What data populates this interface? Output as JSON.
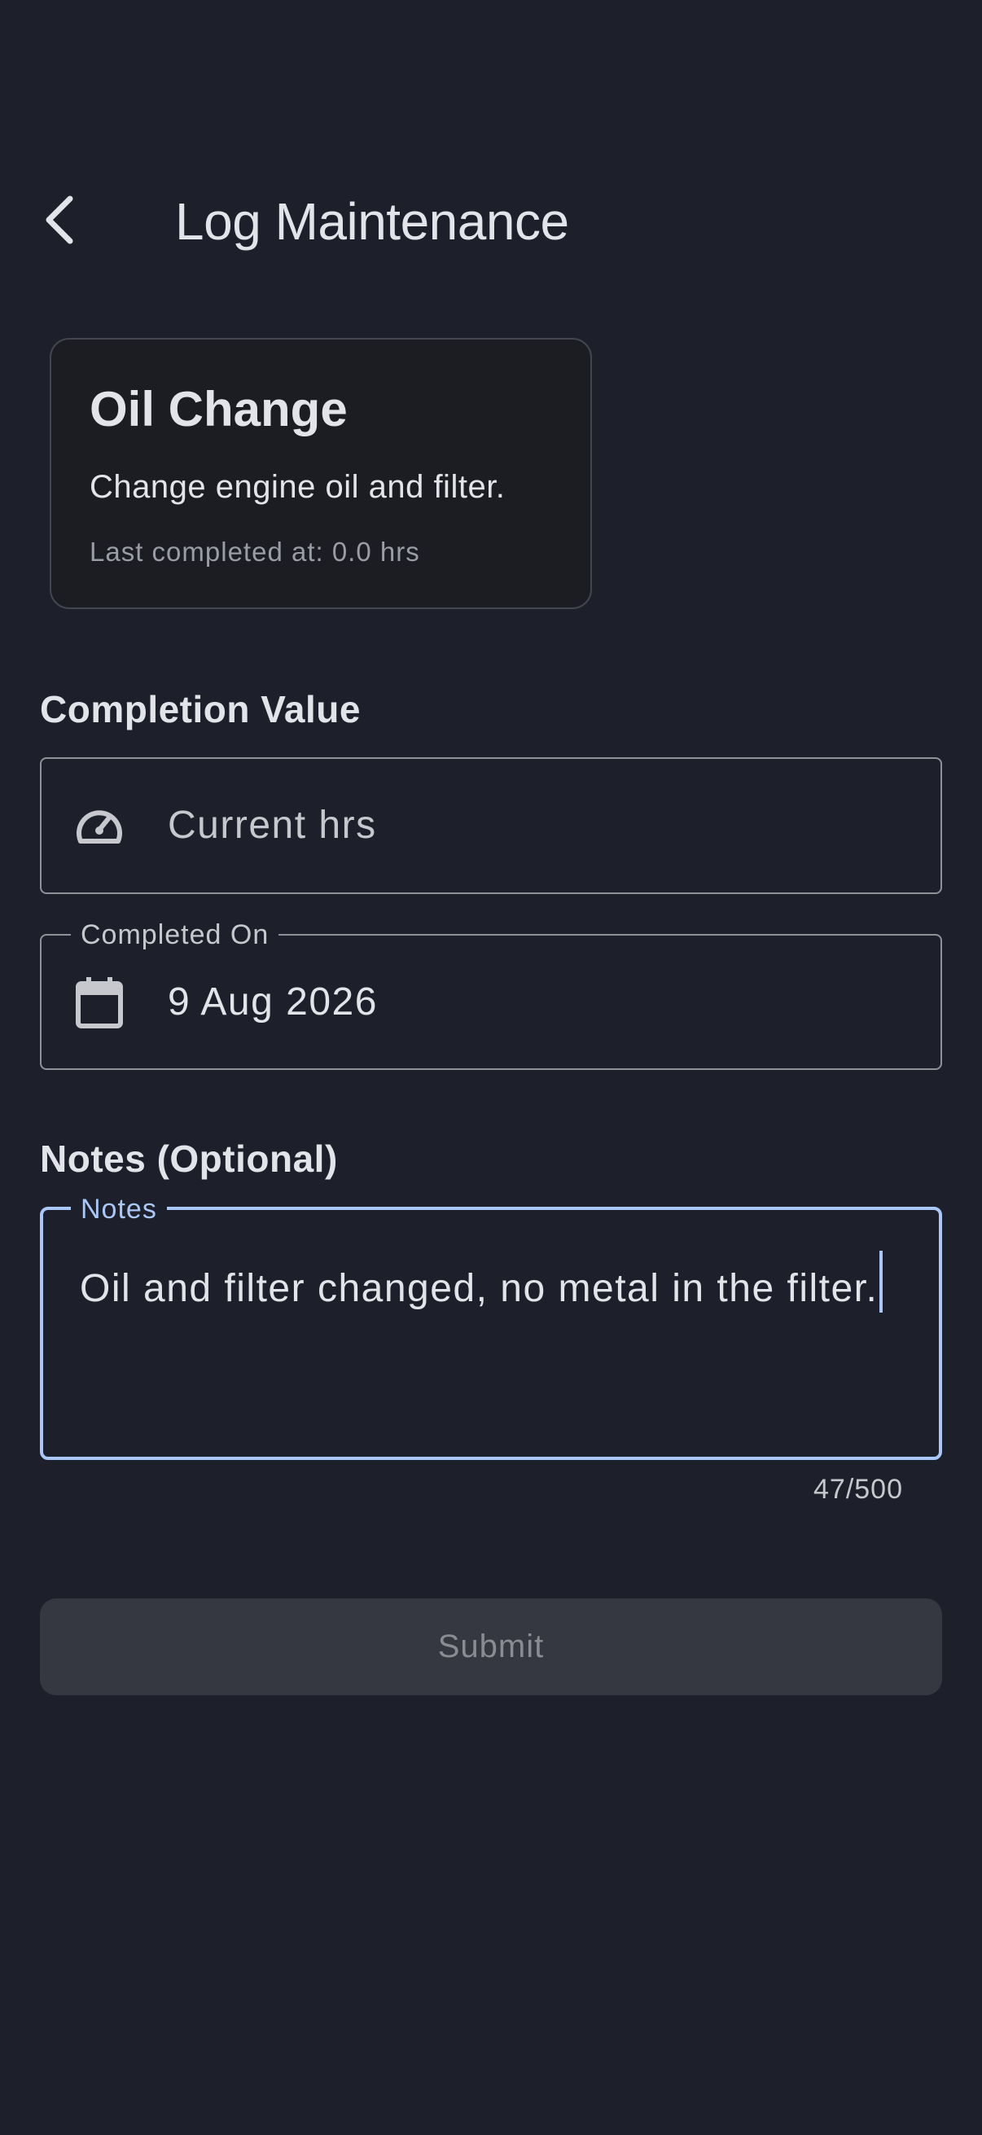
{
  "header": {
    "title": "Log Maintenance",
    "back_icon": "chevron-left-icon"
  },
  "task": {
    "title": "Oil Change",
    "description": "Change engine oil and filter.",
    "last_completed": "Last completed at: 0.0 hrs"
  },
  "completion": {
    "section_label": "Completion Value",
    "icon": "speedometer-icon",
    "placeholder": "Current hrs",
    "value": ""
  },
  "completed_on": {
    "label": "Completed On",
    "icon": "calendar-icon",
    "value": "9 Aug 2026"
  },
  "notes": {
    "section_label": "Notes (Optional)",
    "label": "Notes",
    "value": "Oil and filter changed, no metal in the filter.",
    "counter": "47/500"
  },
  "submit": {
    "label": "Submit"
  },
  "colors": {
    "background": "#1d202a",
    "focus_accent": "#a9c7f7",
    "button_disabled_bg": "#353841"
  }
}
